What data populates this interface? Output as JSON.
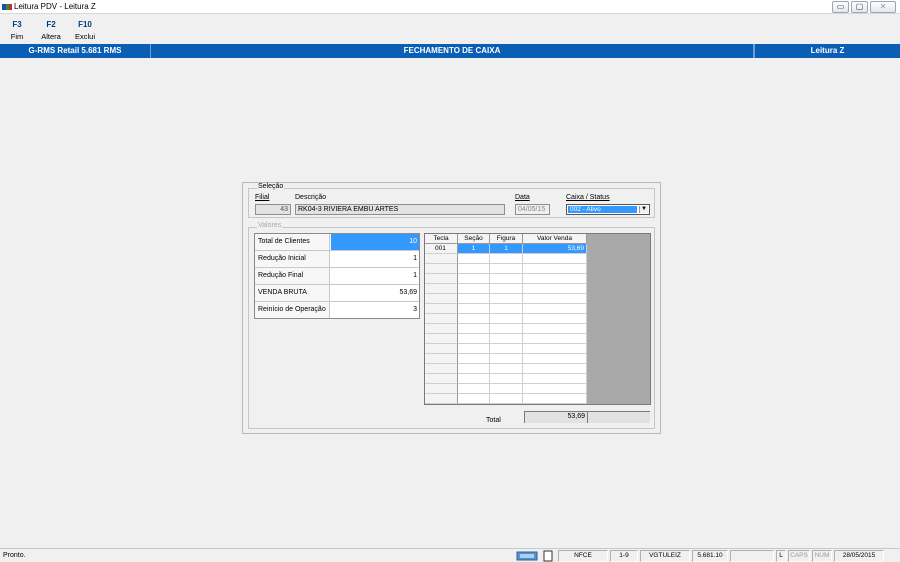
{
  "window": {
    "title": "Leitura PDV - Leitura Z",
    "buttons": [
      "▭",
      "▢",
      "✕"
    ]
  },
  "toolbar": [
    {
      "key": "F3",
      "label": "Fim"
    },
    {
      "key": "F2",
      "label": "Altera"
    },
    {
      "key": "F10",
      "label": "Exclui"
    }
  ],
  "header": {
    "app": "G-RMS Retail 5.681 RMS",
    "title": "FECHAMENTO DE CAIXA",
    "mode": "Leitura Z"
  },
  "selecao": {
    "title": "Seleção",
    "filial_label": "Filial",
    "filial_value": "43",
    "descricao_label": "Descrição",
    "descricao_value": "RK04-3 RIVIERA EMBU ARTES",
    "data_label": "Data",
    "data_value": "04/05/15",
    "caixa_label": "Caixa / Status",
    "caixa_value": "002 - Ativo"
  },
  "valores": {
    "title": "Valores",
    "summary": [
      {
        "label": "Total de Clientes",
        "value": "10",
        "selected": true
      },
      {
        "label": "Redução Inicial",
        "value": "1"
      },
      {
        "label": "Redução Final",
        "value": "1"
      },
      {
        "label": "VENDA BRUTA",
        "value": "53,69"
      },
      {
        "label": "Reinício de Operação",
        "value": "3"
      }
    ],
    "grid": {
      "headers": [
        "Tecla",
        "Seção",
        "Figura",
        "Valor Venda"
      ],
      "rows": [
        [
          "001",
          "1",
          "1",
          "53,69"
        ]
      ]
    },
    "total_label": "Total",
    "total_value": "53,69"
  },
  "status": {
    "ready": "Pronto.",
    "cells": [
      "NFCE",
      "1-9",
      "VGTULEIZ",
      "5.681.10",
      "",
      "L",
      "CAPS",
      "NUM",
      "28/05/2015"
    ],
    "dim": [
      6,
      7
    ]
  },
  "colors": {
    "header_bg": "#0a5fb4",
    "selection": "#3399ff",
    "toolbar_key": "#003a8c"
  }
}
